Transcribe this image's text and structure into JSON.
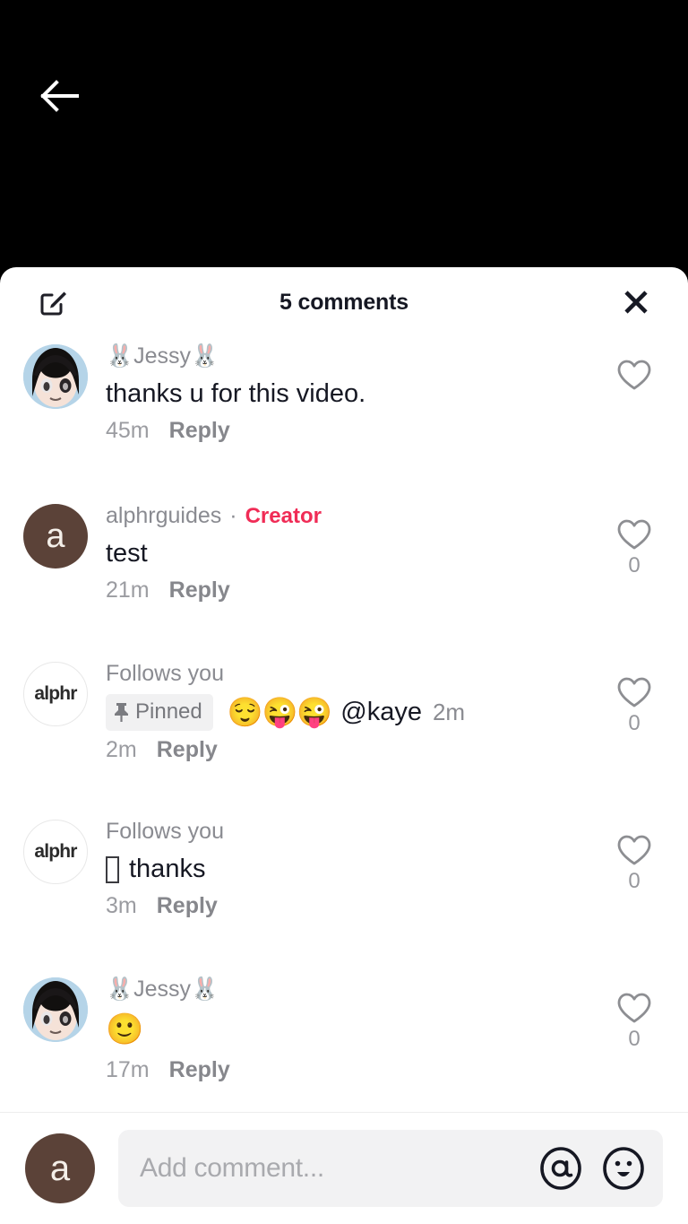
{
  "video": {
    "back_icon": "arrow-left-icon",
    "background_color": "#000000"
  },
  "header": {
    "title": "5 comments",
    "compose_icon": "compose-edit-icon",
    "close_icon": "close-x-icon"
  },
  "colors": {
    "creator_pink": "#F02C56",
    "avatar_brown": "#5B4238",
    "text_primary": "#161823",
    "text_secondary": "#8a8b91",
    "badge_bg": "#f1f1f2",
    "input_bg": "#f2f2f3"
  },
  "comments": [
    {
      "author": "🐰Jessy🐰",
      "avatar_type": "anime",
      "avatar_label": "",
      "badge": "",
      "text": "thanks u for this video.",
      "time": "45m",
      "reply_label": "Reply",
      "like_count": "",
      "like_icon": "heart-outline-icon"
    },
    {
      "author": "alphrguides",
      "avatar_type": "brown",
      "avatar_label": "a",
      "badge": "Creator",
      "text": "test",
      "time": "21m",
      "reply_label": "Reply",
      "like_count": "0",
      "like_icon": "heart-outline-icon"
    },
    {
      "author": "Follows you",
      "avatar_type": "alphr",
      "avatar_label": "alphr",
      "badge": "",
      "pinned_label": "Pinned",
      "pinned_icon": "pushpin-icon",
      "emojis": "😌😜😜",
      "mention": "@kaye",
      "inline_time": "2m",
      "text": "",
      "time": "2m",
      "reply_label": "Reply",
      "like_count": "0",
      "like_icon": "heart-outline-icon"
    },
    {
      "author": "Follows you",
      "avatar_type": "alphr",
      "avatar_label": "alphr",
      "badge": "",
      "text": "thanks",
      "has_tofu": true,
      "time": "3m",
      "reply_label": "Reply",
      "like_count": "0",
      "like_icon": "heart-outline-icon"
    },
    {
      "author": "🐰Jessy🐰",
      "avatar_type": "anime",
      "avatar_label": "",
      "badge": "",
      "text": "🙂",
      "emoji_only": true,
      "time": "17m",
      "reply_label": "Reply",
      "like_count": "0",
      "like_icon": "heart-outline-icon"
    }
  ],
  "input_bar": {
    "avatar_label": "a",
    "placeholder": "Add comment...",
    "mention_icon": "at-mention-icon",
    "emoji_icon": "emoji-face-icon"
  }
}
